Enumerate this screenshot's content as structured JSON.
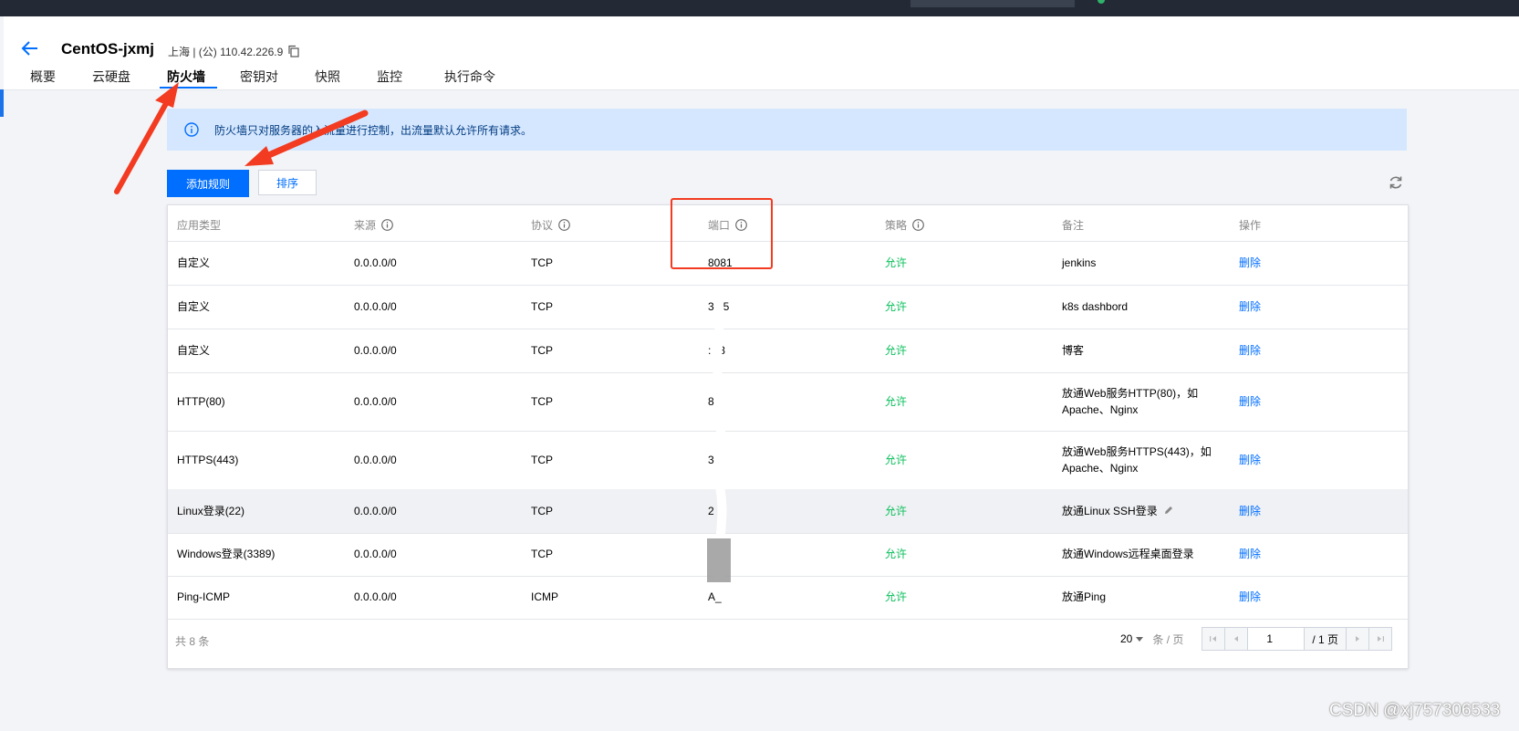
{
  "instance": {
    "name": "CentOS-jxmj",
    "region_ip": "上海 | (公) 110.42.226.9"
  },
  "tabs": [
    {
      "label": "概要"
    },
    {
      "label": "云硬盘"
    },
    {
      "label": "防火墙",
      "active": true
    },
    {
      "label": "密钥对"
    },
    {
      "label": "快照"
    },
    {
      "label": "监控"
    },
    {
      "label": "执行命令"
    }
  ],
  "notice": {
    "text": "防火墙只对服务器的入流量进行控制，出流量默认允许所有请求。"
  },
  "toolbar": {
    "add_rule": "添加规则",
    "sort": "排序"
  },
  "table": {
    "headers": {
      "app_type": "应用类型",
      "source": "来源",
      "protocol": "协议",
      "port": "端口",
      "policy": "策略",
      "note": "备注",
      "action": "操作"
    },
    "rows": [
      {
        "app_type": "自定义",
        "source": "0.0.0.0/0",
        "protocol": "TCP",
        "port": "8081",
        "policy": "允许",
        "note": "jenkins",
        "action": "删除"
      },
      {
        "app_type": "自定义",
        "source": "0.0.0.0/0",
        "protocol": "TCP",
        "port": "3 ; 5",
        "policy": "允许",
        "note": "k8s dashbord",
        "action": "删除"
      },
      {
        "app_type": "自定义",
        "source": "0.0.0.0/0",
        "protocol": "TCP",
        "port": ": ' 3",
        "policy": "允许",
        "note": "博客",
        "action": "删除"
      },
      {
        "app_type": "HTTP(80)",
        "source": "0.0.0.0/0",
        "protocol": "TCP",
        "port": "8",
        "policy": "允许",
        "note": "放通Web服务HTTP(80)，如Apache、Nginx",
        "action": "删除"
      },
      {
        "app_type": "HTTPS(443)",
        "source": "0.0.0.0/0",
        "protocol": "TCP",
        "port": "3",
        "policy": "允许",
        "note": "放通Web服务HTTPS(443)，如Apache、Nginx",
        "action": "删除"
      },
      {
        "app_type": "Linux登录(22)",
        "source": "0.0.0.0/0",
        "protocol": "TCP",
        "port": "2",
        "policy": "允许",
        "note": "放通Linux SSH登录",
        "action": "删除"
      },
      {
        "app_type": "Windows登录(3389)",
        "source": "0.0.0.0/0",
        "protocol": "TCP",
        "port": "",
        "policy": "允许",
        "note": "放通Windows远程桌面登录",
        "action": "删除"
      },
      {
        "app_type": "Ping-ICMP",
        "source": "0.0.0.0/0",
        "protocol": "ICMP",
        "port": "A_",
        "policy": "允许",
        "note": "放通Ping",
        "action": "删除"
      }
    ]
  },
  "pagination": {
    "total": "共 8 条",
    "page_size": "20",
    "per_page_unit": "条 / 页",
    "current_page": "1",
    "total_pages": "/ 1 页"
  },
  "watermark": "CSDN @xj757306533",
  "colors": {
    "primary": "#006eff",
    "allow": "#0abf5b",
    "annotation": "#f23b21",
    "notice_bg": "#d5e7ff"
  }
}
